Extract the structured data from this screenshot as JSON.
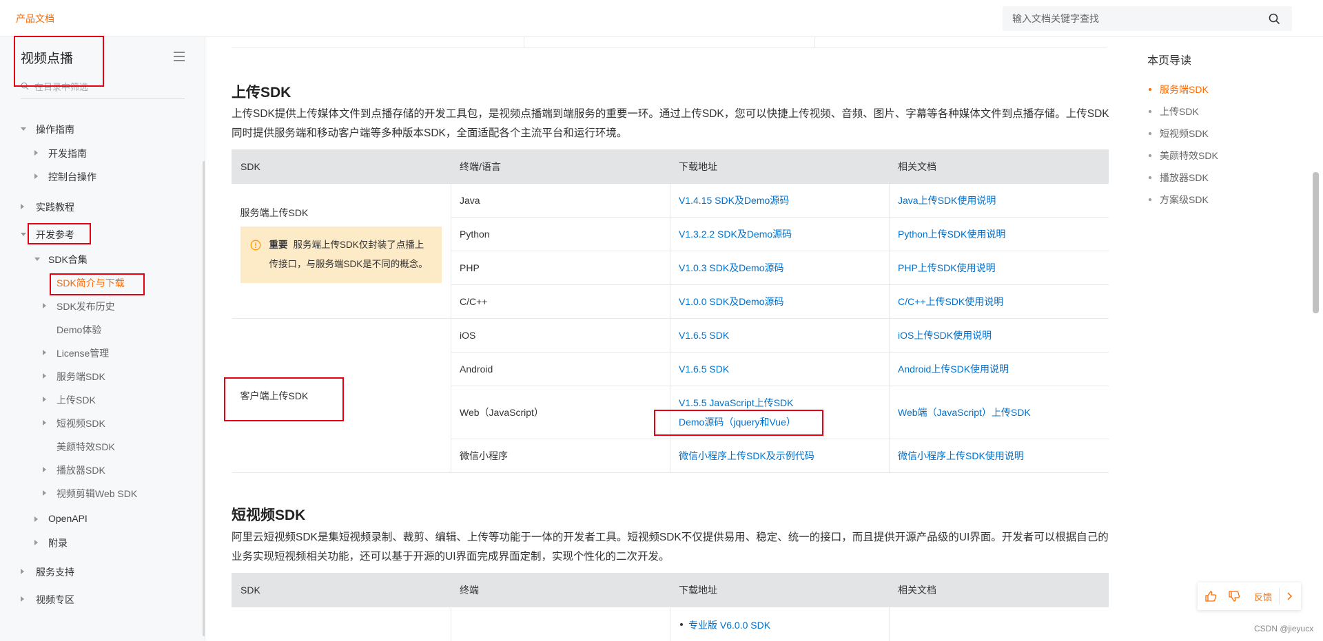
{
  "header": {
    "brand": "产品文档",
    "search_placeholder": "输入文档关键字查找"
  },
  "sidebar": {
    "title": "视频点播",
    "filter_placeholder": "在目录中筛选",
    "items": [
      {
        "label": "操作指南",
        "level": 0,
        "state": "expanded"
      },
      {
        "label": "开发指南",
        "level": 1,
        "state": "collapsed"
      },
      {
        "label": "控制台操作",
        "level": 1,
        "state": "collapsed"
      },
      {
        "label": "实践教程",
        "level": 0,
        "state": "collapsed"
      },
      {
        "label": "开发参考",
        "level": 0,
        "state": "expanded"
      },
      {
        "label": "SDK合集",
        "level": 1,
        "state": "expanded"
      },
      {
        "label": "SDK简介与下载",
        "level": 2,
        "state": "active"
      },
      {
        "label": "SDK发布历史",
        "level": 2,
        "state": "collapsed"
      },
      {
        "label": "Demo体验",
        "level": 2,
        "state": "leaf"
      },
      {
        "label": "License管理",
        "level": 2,
        "state": "collapsed"
      },
      {
        "label": "服务端SDK",
        "level": 2,
        "state": "collapsed"
      },
      {
        "label": "上传SDK",
        "level": 2,
        "state": "collapsed"
      },
      {
        "label": "短视频SDK",
        "level": 2,
        "state": "collapsed"
      },
      {
        "label": "美颜特效SDK",
        "level": 2,
        "state": "leaf"
      },
      {
        "label": "播放器SDK",
        "level": 2,
        "state": "collapsed"
      },
      {
        "label": "视频剪辑Web SDK",
        "level": 2,
        "state": "collapsed"
      },
      {
        "label": "OpenAPI",
        "level": 1,
        "state": "collapsed"
      },
      {
        "label": "附录",
        "level": 1,
        "state": "collapsed"
      },
      {
        "label": "服务支持",
        "level": 0,
        "state": "collapsed"
      },
      {
        "label": "视频专区",
        "level": 0,
        "state": "collapsed"
      }
    ]
  },
  "upload": {
    "heading": "上传SDK",
    "paragraph": "上传SDK提供上传媒体文件到点播存储的开发工具包，是视频点播端到端服务的重要一环。通过上传SDK，您可以快捷上传视频、音频、图片、字幕等各种媒体文件到点播存储。上传SDK同时提供服务端和移动客户端等多种版本SDK，全面适配各个主流平台和运行环境。",
    "headers": [
      "SDK",
      "终端/语言",
      "下载地址",
      "相关文档"
    ],
    "server_group": "服务端上传SDK",
    "notice_strong": "重要",
    "notice_text": "服务端上传SDK仅封装了点播上传接口，与服务端SDK是不同的概念。",
    "client_group": "客户端上传SDK",
    "rows": [
      {
        "lang": "Java",
        "download": "V1.4.15 SDK及Demo源码",
        "doc": "Java上传SDK使用说明"
      },
      {
        "lang": "Python",
        "download": "V1.3.2.2 SDK及Demo源码",
        "doc": "Python上传SDK使用说明"
      },
      {
        "lang": "PHP",
        "download": "V1.0.3 SDK及Demo源码",
        "doc": "PHP上传SDK使用说明"
      },
      {
        "lang": "C/C++",
        "download": "V1.0.0 SDK及Demo源码",
        "doc": "C/C++上传SDK使用说明"
      },
      {
        "lang": "iOS",
        "download": "V1.6.5 SDK",
        "doc": "iOS上传SDK使用说明"
      },
      {
        "lang": "Android",
        "download": "V1.6.5 SDK",
        "doc": "Android上传SDK使用说明"
      },
      {
        "lang": "Web（JavaScript）",
        "download": "V1.5.5 JavaScript上传SDK",
        "download2": "Demo源码（jquery和Vue）",
        "doc": "Web端（JavaScript）上传SDK"
      },
      {
        "lang": "微信小程序",
        "download": "微信小程序上传SDK及示例代码",
        "doc": "微信小程序上传SDK使用说明"
      }
    ]
  },
  "short_video": {
    "heading": "短视频SDK",
    "paragraph": "阿里云短视频SDK是集短视频录制、裁剪、编辑、上传等功能于一体的开发者工具。短视频SDK不仅提供易用、稳定、统一的接口，而且提供开源产品级的UI界面。开发者可以根据自己的业务实现短视频相关功能，还可以基于开源的UI界面完成界面定制，实现个性化的二次开发。",
    "headers": [
      "SDK",
      "终端",
      "下载地址",
      "相关文档"
    ],
    "first_download": "专业版 V6.0.0 SDK"
  },
  "toc": {
    "title": "本页导读",
    "items": [
      "服务端SDK",
      "上传SDK",
      "短视频SDK",
      "美颜特效SDK",
      "播放器SDK",
      "方案级SDK"
    ]
  },
  "feedback": {
    "label": "反馈"
  },
  "watermark": "CSDN @jieyucx",
  "colors": {
    "accent": "#ff6a00",
    "link": "#0070cc",
    "annotation": "#e60012",
    "notice_bg": "#fdebc8"
  }
}
